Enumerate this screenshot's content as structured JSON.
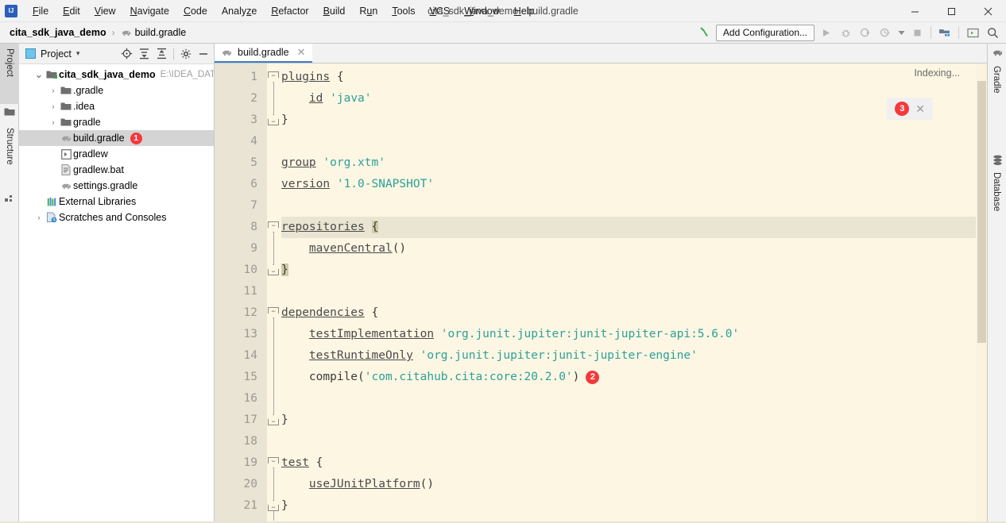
{
  "window": {
    "title": "cita_sdk_java_demo - build.gradle",
    "logo_icon": "intellij-idea-logo",
    "minimize_label": "─",
    "maximize_label": "☐",
    "close_label": "✕"
  },
  "menubar": {
    "items": [
      {
        "label": "File",
        "mnemonic": "F"
      },
      {
        "label": "Edit",
        "mnemonic": "E"
      },
      {
        "label": "View",
        "mnemonic": "V"
      },
      {
        "label": "Navigate",
        "mnemonic": "N"
      },
      {
        "label": "Code",
        "mnemonic": "C"
      },
      {
        "label": "Analyze",
        "mnemonic": "z"
      },
      {
        "label": "Refactor",
        "mnemonic": "R"
      },
      {
        "label": "Build",
        "mnemonic": "B"
      },
      {
        "label": "Run",
        "mnemonic": "u"
      },
      {
        "label": "Tools",
        "mnemonic": "T"
      },
      {
        "label": "VCS",
        "mnemonic": "V"
      },
      {
        "label": "Window",
        "mnemonic": "W"
      },
      {
        "label": "Help",
        "mnemonic": "H"
      }
    ]
  },
  "navbar": {
    "breadcrumbs": [
      {
        "label": "cita_sdk_java_demo",
        "icon": ""
      },
      {
        "label": "build.gradle",
        "icon": "gradle-elephant-icon"
      }
    ],
    "separator": "›",
    "add_configuration_label": "Add Configuration...",
    "icons": [
      {
        "name": "build-hammer-icon",
        "glyph": "↖"
      },
      {
        "name": "run-icon",
        "glyph": "▶"
      },
      {
        "name": "debug-icon",
        "glyph": "🐞"
      },
      {
        "name": "run-with-coverage-icon",
        "glyph": "◔"
      },
      {
        "name": "profile-icon",
        "glyph": "◴"
      },
      {
        "name": "dropdown-arrow-icon",
        "glyph": "▾"
      },
      {
        "name": "stop-icon",
        "glyph": "■"
      },
      {
        "name": "project-structure-icon",
        "glyph": "▣"
      },
      {
        "name": "terminal-icon",
        "glyph": "▧"
      },
      {
        "name": "search-everywhere-icon",
        "glyph": "⚲"
      }
    ]
  },
  "left_tool_strip": {
    "tabs": [
      {
        "label": "Project",
        "icon": "project-folder-icon",
        "active": true
      },
      {
        "label": "Structure",
        "icon": "structure-icon",
        "active": false
      }
    ]
  },
  "right_tool_strip": {
    "tabs": [
      {
        "label": "Gradle",
        "icon": "gradle-elephant-icon"
      },
      {
        "label": "Database",
        "icon": "database-icon"
      }
    ]
  },
  "project_panel": {
    "title": "Project",
    "dropdown_glyph": "▾",
    "tools": [
      {
        "name": "locate-icon",
        "glyph": "⊕"
      },
      {
        "name": "expand-all-icon",
        "glyph": "⤓"
      },
      {
        "name": "collapse-all-icon",
        "glyph": "⤒"
      },
      {
        "name": "settings-gear-icon",
        "glyph": "⚙"
      },
      {
        "name": "hide-icon",
        "glyph": "─"
      }
    ],
    "tree": [
      {
        "label": "cita_sdk_java_demo",
        "path": "E:\\IDEA_DATA\\",
        "arrow": "∨",
        "icon": "module-folder-icon",
        "indent": 0,
        "bold": true,
        "selected": false,
        "badge": ""
      },
      {
        "label": ".gradle",
        "path": "",
        "arrow": "›",
        "icon": "folder-icon",
        "indent": 1,
        "bold": false,
        "selected": false,
        "badge": ""
      },
      {
        "label": ".idea",
        "path": "",
        "arrow": "›",
        "icon": "folder-icon",
        "indent": 1,
        "bold": false,
        "selected": false,
        "badge": ""
      },
      {
        "label": "gradle",
        "path": "",
        "arrow": "›",
        "icon": "folder-icon",
        "indent": 1,
        "bold": false,
        "selected": false,
        "badge": ""
      },
      {
        "label": "build.gradle",
        "path": "",
        "arrow": "",
        "icon": "gradle-elephant-icon",
        "indent": 1,
        "bold": false,
        "selected": true,
        "badge": "1"
      },
      {
        "label": "gradlew",
        "path": "",
        "arrow": "",
        "icon": "script-icon",
        "indent": 1,
        "bold": false,
        "selected": false,
        "badge": ""
      },
      {
        "label": "gradlew.bat",
        "path": "",
        "arrow": "",
        "icon": "bat-file-icon",
        "indent": 1,
        "bold": false,
        "selected": false,
        "badge": ""
      },
      {
        "label": "settings.gradle",
        "path": "",
        "arrow": "",
        "icon": "gradle-elephant-icon",
        "indent": 1,
        "bold": false,
        "selected": false,
        "badge": ""
      },
      {
        "label": "External Libraries",
        "path": "",
        "arrow": "",
        "icon": "libraries-icon",
        "indent": 0,
        "bold": false,
        "selected": false,
        "badge": ""
      },
      {
        "label": "Scratches and Consoles",
        "path": "",
        "arrow": "›",
        "icon": "scratches-icon",
        "indent": 0,
        "bold": false,
        "selected": false,
        "badge": ""
      }
    ]
  },
  "editor": {
    "tab": {
      "label": "build.gradle",
      "icon": "gradle-elephant-icon",
      "close_glyph": "✕"
    },
    "status_text": "Indexing...",
    "notification": {
      "count": "3",
      "close_glyph": "✕"
    },
    "inline_badge": "2",
    "line_numbers": [
      "1",
      "2",
      "3",
      "4",
      "5",
      "6",
      "7",
      "8",
      "9",
      "10",
      "11",
      "12",
      "13",
      "14",
      "15",
      "16",
      "17",
      "18",
      "19",
      "20",
      "21"
    ],
    "lines": [
      {
        "n": 1,
        "highlight": false,
        "fold": "open",
        "tokens": [
          {
            "t": "kw",
            "v": "plugins"
          },
          {
            "t": "plain",
            "v": " {"
          }
        ]
      },
      {
        "n": 2,
        "highlight": false,
        "fold": "",
        "tokens": [
          {
            "t": "plain",
            "v": "    "
          },
          {
            "t": "kw",
            "v": "id"
          },
          {
            "t": "plain",
            "v": " "
          },
          {
            "t": "str",
            "v": "'java'"
          }
        ]
      },
      {
        "n": 3,
        "highlight": false,
        "fold": "close",
        "tokens": [
          {
            "t": "plain",
            "v": "}"
          }
        ]
      },
      {
        "n": 4,
        "highlight": false,
        "fold": "",
        "tokens": [
          {
            "t": "plain",
            "v": ""
          }
        ]
      },
      {
        "n": 5,
        "highlight": false,
        "fold": "",
        "tokens": [
          {
            "t": "kw",
            "v": "group"
          },
          {
            "t": "plain",
            "v": " "
          },
          {
            "t": "str",
            "v": "'org.xtm'"
          }
        ]
      },
      {
        "n": 6,
        "highlight": false,
        "fold": "",
        "tokens": [
          {
            "t": "kw",
            "v": "version"
          },
          {
            "t": "plain",
            "v": " "
          },
          {
            "t": "str",
            "v": "'1.0-SNAPSHOT'"
          }
        ]
      },
      {
        "n": 7,
        "highlight": false,
        "fold": "",
        "tokens": [
          {
            "t": "plain",
            "v": ""
          }
        ]
      },
      {
        "n": 8,
        "highlight": true,
        "fold": "open",
        "tokens": [
          {
            "t": "kw",
            "v": "repositories"
          },
          {
            "t": "plain",
            "v": " "
          },
          {
            "t": "brace",
            "v": "{"
          }
        ]
      },
      {
        "n": 9,
        "highlight": false,
        "fold": "",
        "tokens": [
          {
            "t": "plain",
            "v": "    "
          },
          {
            "t": "fn",
            "v": "mavenCentral"
          },
          {
            "t": "plain",
            "v": "()"
          }
        ]
      },
      {
        "n": 10,
        "highlight": false,
        "fold": "close",
        "tokens": [
          {
            "t": "brace",
            "v": "}"
          }
        ]
      },
      {
        "n": 11,
        "highlight": false,
        "fold": "",
        "tokens": [
          {
            "t": "plain",
            "v": ""
          }
        ]
      },
      {
        "n": 12,
        "highlight": false,
        "fold": "open",
        "tokens": [
          {
            "t": "kw",
            "v": "dependencies"
          },
          {
            "t": "plain",
            "v": " {"
          }
        ]
      },
      {
        "n": 13,
        "highlight": false,
        "fold": "",
        "tokens": [
          {
            "t": "plain",
            "v": "    "
          },
          {
            "t": "fn",
            "v": "testImplementation"
          },
          {
            "t": "plain",
            "v": " "
          },
          {
            "t": "str",
            "v": "'org.junit.jupiter:junit-jupiter-api:5.6.0'"
          }
        ]
      },
      {
        "n": 14,
        "highlight": false,
        "fold": "",
        "tokens": [
          {
            "t": "plain",
            "v": "    "
          },
          {
            "t": "fn",
            "v": "testRuntimeOnly"
          },
          {
            "t": "plain",
            "v": " "
          },
          {
            "t": "str",
            "v": "'org.junit.jupiter:junit-jupiter-engine'"
          }
        ]
      },
      {
        "n": 15,
        "highlight": false,
        "fold": "",
        "tokens": [
          {
            "t": "plain",
            "v": "    compile("
          },
          {
            "t": "str",
            "v": "'com.citahub.cita:core:20.2.0'"
          },
          {
            "t": "plain",
            "v": ")"
          },
          {
            "t": "badge",
            "v": "2"
          }
        ]
      },
      {
        "n": 16,
        "highlight": false,
        "fold": "",
        "tokens": [
          {
            "t": "plain",
            "v": ""
          }
        ]
      },
      {
        "n": 17,
        "highlight": false,
        "fold": "close",
        "tokens": [
          {
            "t": "plain",
            "v": "}"
          }
        ]
      },
      {
        "n": 18,
        "highlight": false,
        "fold": "",
        "tokens": [
          {
            "t": "plain",
            "v": ""
          }
        ]
      },
      {
        "n": 19,
        "highlight": false,
        "fold": "open",
        "tokens": [
          {
            "t": "kw",
            "v": "test"
          },
          {
            "t": "plain",
            "v": " {"
          }
        ]
      },
      {
        "n": 20,
        "highlight": false,
        "fold": "",
        "tokens": [
          {
            "t": "plain",
            "v": "    "
          },
          {
            "t": "fn",
            "v": "useJUnitPlatform"
          },
          {
            "t": "plain",
            "v": "()"
          }
        ]
      },
      {
        "n": 21,
        "highlight": false,
        "fold": "close",
        "tokens": [
          {
            "t": "plain",
            "v": "}"
          }
        ]
      }
    ]
  },
  "colors": {
    "editor_bg": "#fdf6e3",
    "gutter_bg": "#e9e4d3",
    "string": "#2aa198",
    "keyword": "#4a4a4a",
    "badge_red": "#f5383b",
    "tab_accent": "#3d7ec4",
    "chrome_bg": "#f2f2f2"
  }
}
